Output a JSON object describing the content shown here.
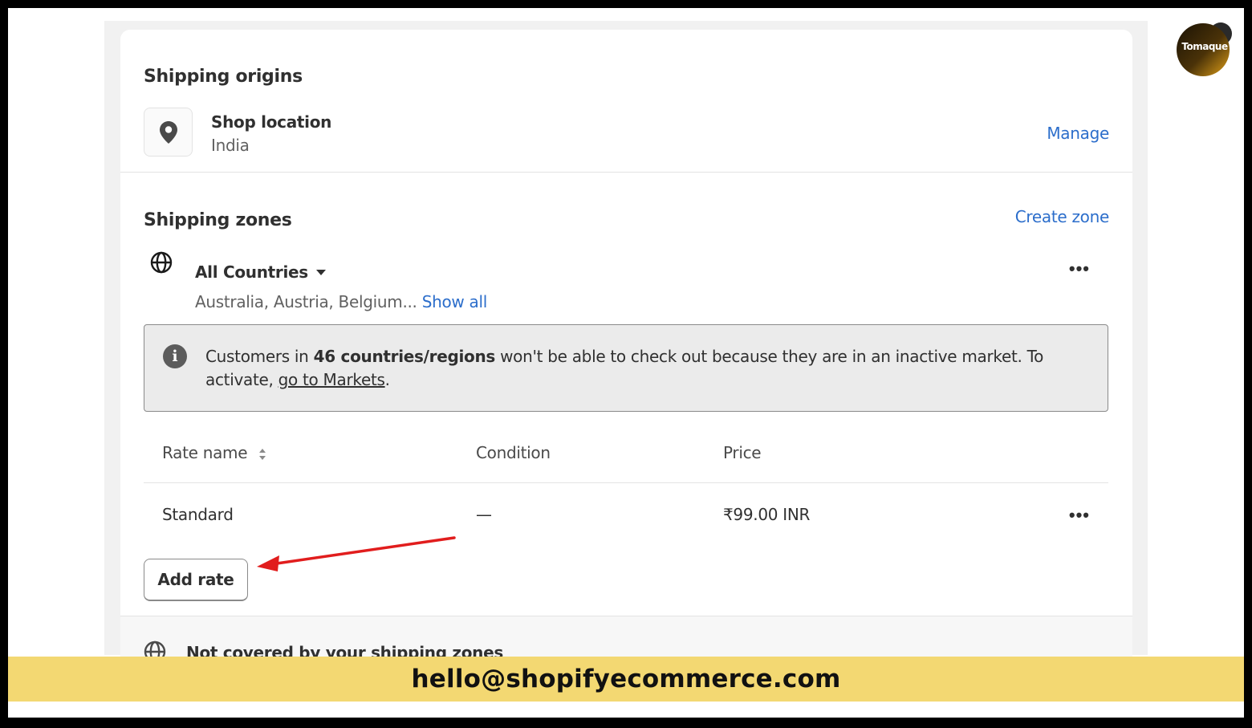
{
  "origins": {
    "title": "Shipping origins",
    "location_title": "Shop location",
    "location_country": "India",
    "manage_label": "Manage"
  },
  "zones": {
    "title": "Shipping zones",
    "create_label": "Create zone",
    "zone_name": "All Countries",
    "zone_countries": "Australia, Austria, Belgium...",
    "show_all_label": "Show all",
    "more_label": "•••",
    "banner": {
      "text_before": "Customers in ",
      "count_bold": "46 countries/regions",
      "text_after": " won't be able to check out because they are in an inactive market. To activate, ",
      "link_text": "go to Markets",
      "period": "."
    },
    "table": {
      "headers": [
        "Rate name",
        "Condition",
        "Price"
      ],
      "rows": [
        {
          "name": "Standard",
          "condition": "—",
          "price": "₹99.00 INR"
        }
      ]
    },
    "add_rate_label": "Add rate",
    "not_covered_label": "Not covered by your shipping zones"
  },
  "logo": {
    "text": "Tomaque"
  },
  "footer": {
    "email": "hello@shopifyecommerce.com"
  },
  "colors": {
    "link": "#2c6ecb",
    "annotation_arrow": "#e11d1d",
    "footer_bar": "#f3d872"
  }
}
